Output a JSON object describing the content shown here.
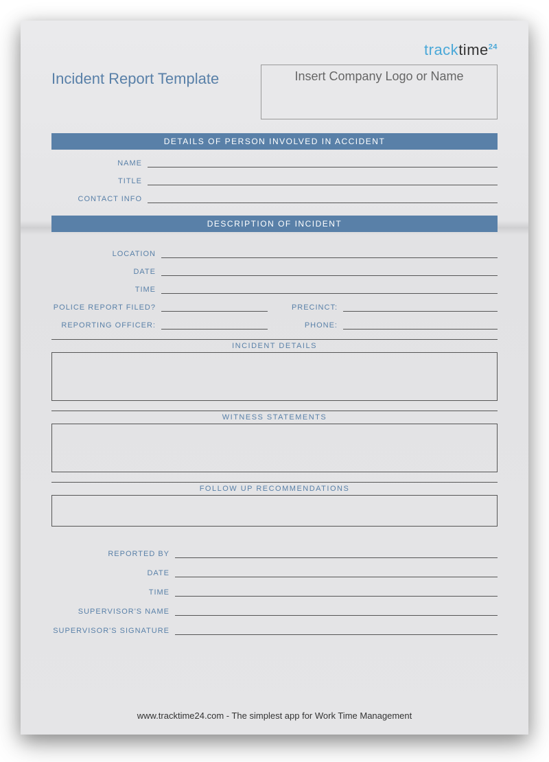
{
  "brand": {
    "part1": "track",
    "part2": "time",
    "suffix": "24"
  },
  "pageTitle": "Incident Report Template",
  "logoPlaceholder": "Insert Company Logo or Name",
  "sections": {
    "person": {
      "title": "DETAILS OF PERSON INVOLVED IN ACCIDENT",
      "fields": {
        "name": "NAME",
        "title": "TITLE",
        "contact": "CONTACT INFO"
      }
    },
    "incident": {
      "title": "DESCRIPTION OF INCIDENT",
      "fields": {
        "location": "LOCATION",
        "date": "DATE",
        "time": "TIME",
        "policeFiled": "POLICE REPORT FILED?",
        "precinct": "PRECINCT:",
        "officer": "REPORTING OFFICER:",
        "phone": "PHONE:"
      },
      "subsections": {
        "details": "INCIDENT DETAILS",
        "witness": "WITNESS STATEMENTS",
        "followup": "FOLLOW UP RECOMMENDATIONS"
      }
    },
    "signoff": {
      "reportedBy": "REPORTED BY",
      "date": "DATE",
      "time": "TIME",
      "supervisorName": "SUPERVISOR'S NAME",
      "supervisorSig": "SUPERVISOR'S SIGNATURE"
    }
  },
  "footer": "www.tracktime24.com - The simplest app for Work Time Management"
}
